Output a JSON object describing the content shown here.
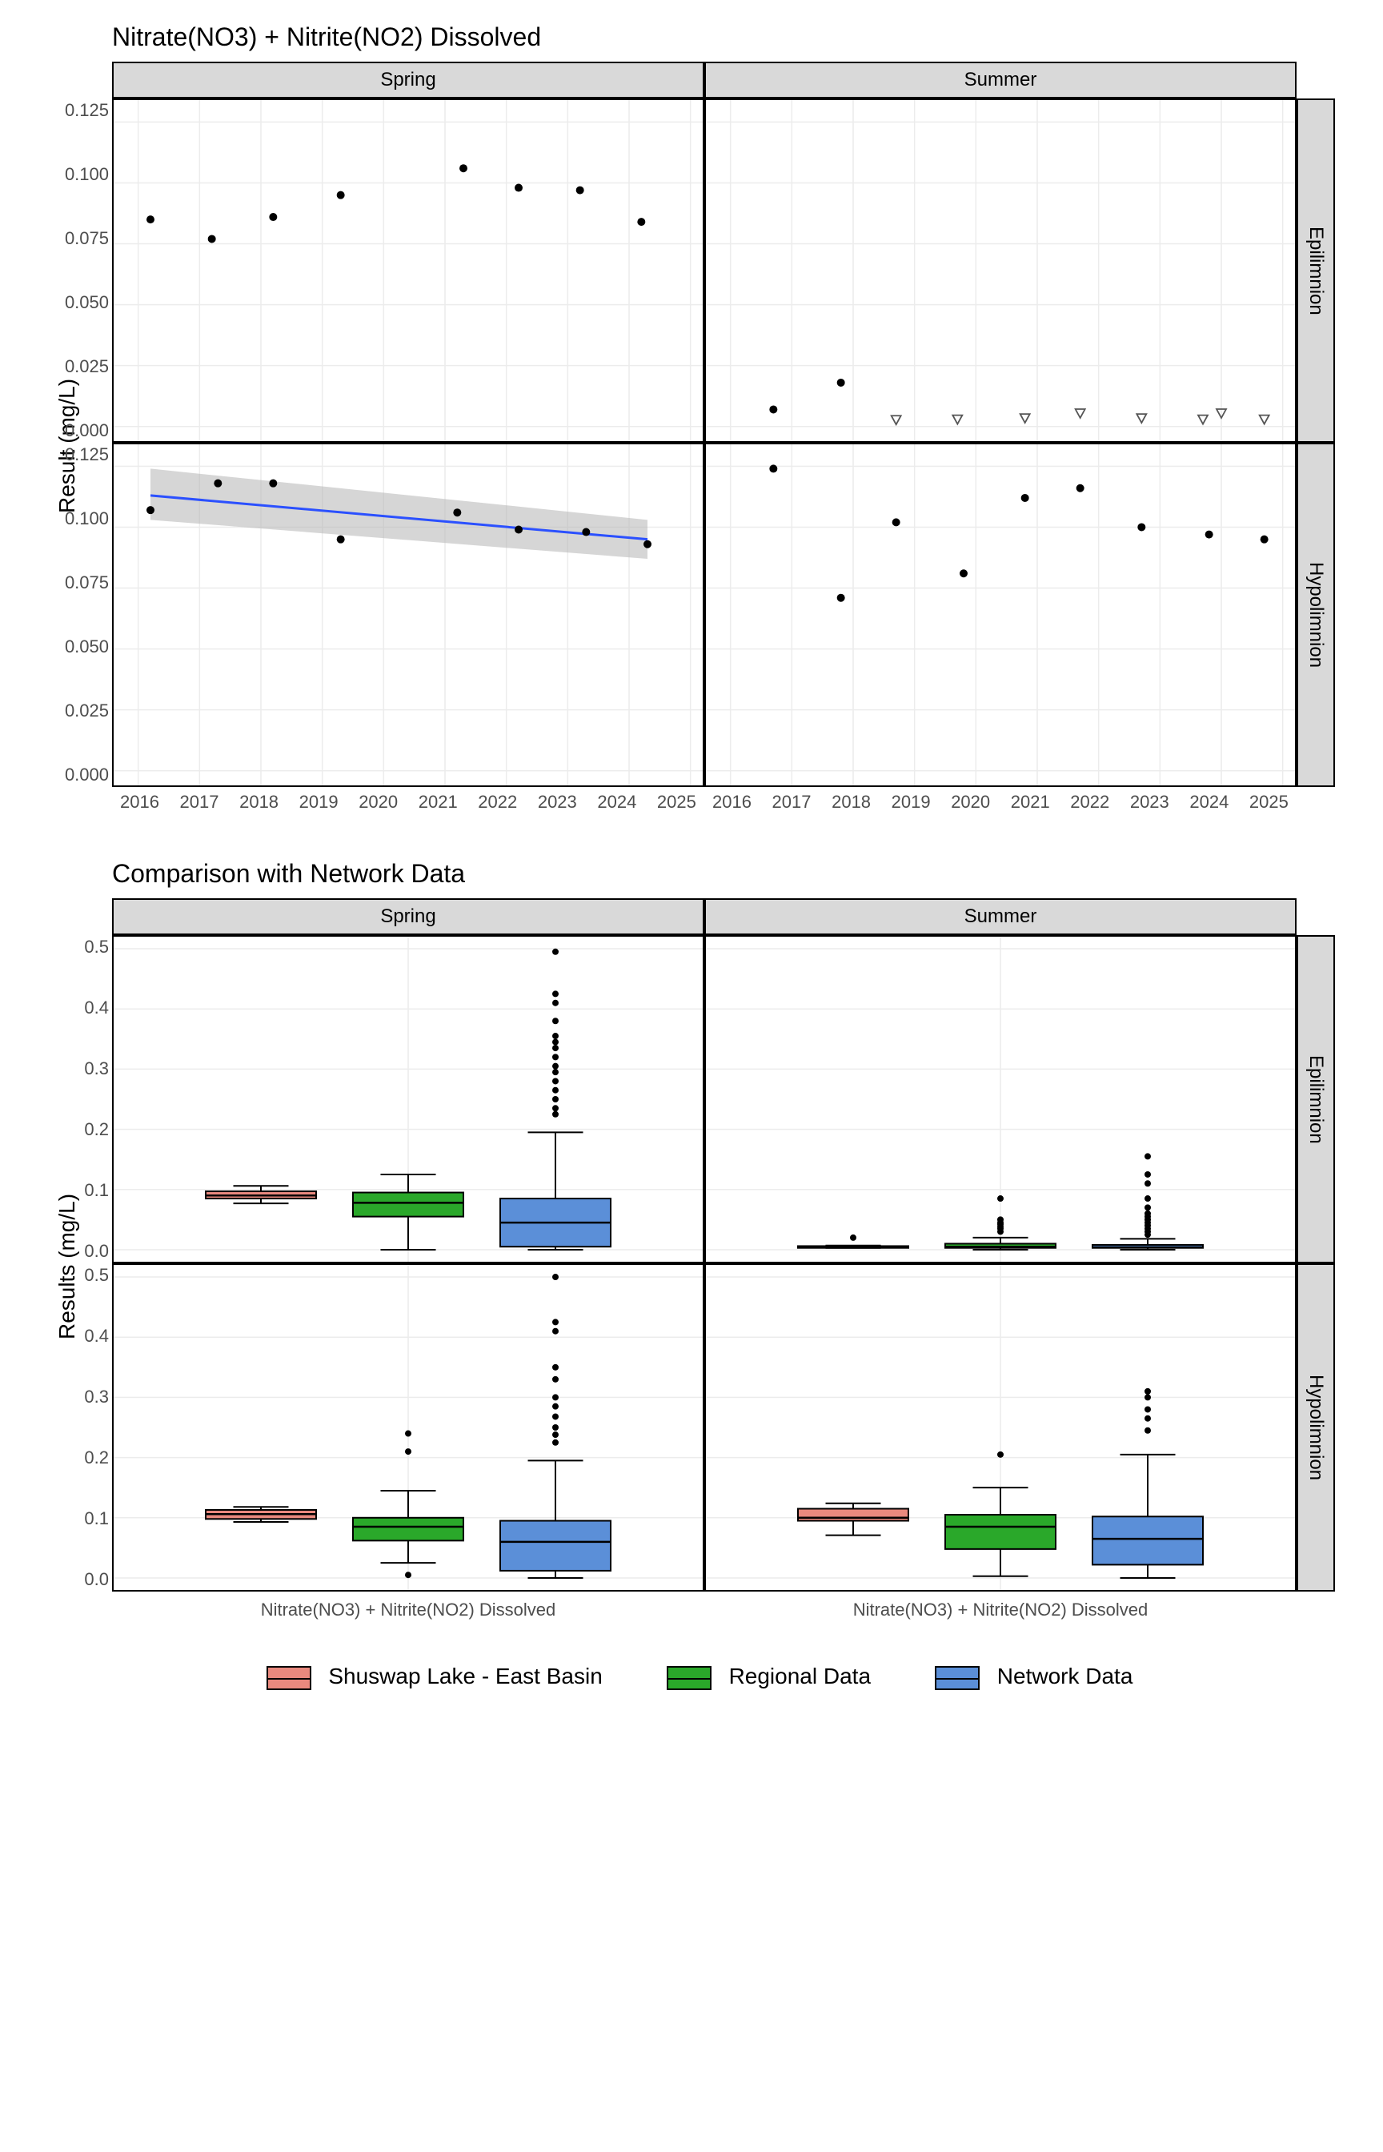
{
  "scatter": {
    "title": "Nitrate(NO3) + Nitrite(NO2) Dissolved",
    "ylabel": "Result (mg/L)",
    "cols": [
      "Spring",
      "Summer"
    ],
    "rows": [
      "Epilimnion",
      "Hypolimnion"
    ],
    "x_ticks": [
      "2016",
      "2017",
      "2018",
      "2019",
      "2020",
      "2021",
      "2022",
      "2023",
      "2024",
      "2025"
    ],
    "y_ticks": [
      "0.000",
      "0.025",
      "0.050",
      "0.075",
      "0.100",
      "0.125"
    ],
    "x_range": [
      2015.6,
      2025.2
    ],
    "y_range": [
      -0.006,
      0.134
    ]
  },
  "box": {
    "title": "Comparison with Network Data",
    "ylabel": "Results (mg/L)",
    "cols": [
      "Spring",
      "Summer"
    ],
    "rows": [
      "Epilimnion",
      "Hypolimnion"
    ],
    "y_ticks": [
      "0.0",
      "0.1",
      "0.2",
      "0.3",
      "0.4",
      "0.5"
    ],
    "y_range": [
      -0.02,
      0.52
    ],
    "category": "Nitrate(NO3) + Nitrite(NO2) Dissolved"
  },
  "legend": [
    {
      "label": "Shuswap Lake - East Basin",
      "color": "#e9897e"
    },
    {
      "label": "Regional Data",
      "color": "#2aa82a"
    },
    {
      "label": "Network Data",
      "color": "#5b8fd8"
    }
  ],
  "chart_data": {
    "scatter_panels": [
      {
        "col": "Spring",
        "row": "Epilimnion",
        "points": [
          {
            "x": 2016.2,
            "y": 0.085
          },
          {
            "x": 2017.2,
            "y": 0.077
          },
          {
            "x": 2018.2,
            "y": 0.086
          },
          {
            "x": 2019.3,
            "y": 0.095
          },
          {
            "x": 2021.3,
            "y": 0.106
          },
          {
            "x": 2022.2,
            "y": 0.098
          },
          {
            "x": 2023.2,
            "y": 0.097
          },
          {
            "x": 2024.2,
            "y": 0.084
          }
        ]
      },
      {
        "col": "Summer",
        "row": "Epilimnion",
        "points": [
          {
            "x": 2016.7,
            "y": 0.007
          },
          {
            "x": 2017.8,
            "y": 0.018
          }
        ],
        "open_points": [
          {
            "x": 2018.7,
            "y": 0.0028
          },
          {
            "x": 2019.7,
            "y": 0.003
          },
          {
            "x": 2020.8,
            "y": 0.0035
          },
          {
            "x": 2021.7,
            "y": 0.0055
          },
          {
            "x": 2022.7,
            "y": 0.0035
          },
          {
            "x": 2023.7,
            "y": 0.003
          },
          {
            "x": 2024.0,
            "y": 0.0055
          },
          {
            "x": 2024.7,
            "y": 0.003
          }
        ]
      },
      {
        "col": "Spring",
        "row": "Hypolimnion",
        "points": [
          {
            "x": 2016.2,
            "y": 0.107
          },
          {
            "x": 2017.3,
            "y": 0.118
          },
          {
            "x": 2018.2,
            "y": 0.118
          },
          {
            "x": 2019.3,
            "y": 0.095
          },
          {
            "x": 2021.2,
            "y": 0.106
          },
          {
            "x": 2022.2,
            "y": 0.099
          },
          {
            "x": 2023.3,
            "y": 0.098
          },
          {
            "x": 2024.3,
            "y": 0.093
          }
        ],
        "trend": {
          "x0": 2016.2,
          "y0": 0.113,
          "x1": 2024.3,
          "y1": 0.095,
          "band": [
            [
              2016.2,
              0.103,
              0.124
            ],
            [
              2024.3,
              0.087,
              0.103
            ]
          ]
        }
      },
      {
        "col": "Summer",
        "row": "Hypolimnion",
        "points": [
          {
            "x": 2016.7,
            "y": 0.124
          },
          {
            "x": 2017.8,
            "y": 0.071
          },
          {
            "x": 2018.7,
            "y": 0.102
          },
          {
            "x": 2019.8,
            "y": 0.081
          },
          {
            "x": 2020.8,
            "y": 0.112
          },
          {
            "x": 2021.7,
            "y": 0.116
          },
          {
            "x": 2022.7,
            "y": 0.1
          },
          {
            "x": 2023.8,
            "y": 0.097
          },
          {
            "x": 2024.7,
            "y": 0.095
          }
        ]
      }
    ],
    "box_panels": [
      {
        "col": "Spring",
        "row": "Epilimnion",
        "boxes": [
          {
            "series": "Shuswap Lake - East Basin",
            "min": 0.077,
            "q1": 0.085,
            "med": 0.09,
            "q3": 0.097,
            "max": 0.106,
            "outliers": []
          },
          {
            "series": "Regional Data",
            "min": 0.0,
            "q1": 0.055,
            "med": 0.078,
            "q3": 0.095,
            "max": 0.125,
            "outliers": []
          },
          {
            "series": "Network Data",
            "min": 0.0,
            "q1": 0.005,
            "med": 0.045,
            "q3": 0.085,
            "max": 0.195,
            "outliers": [
              0.225,
              0.235,
              0.25,
              0.265,
              0.28,
              0.295,
              0.305,
              0.32,
              0.335,
              0.345,
              0.355,
              0.38,
              0.41,
              0.425,
              0.495
            ]
          }
        ]
      },
      {
        "col": "Summer",
        "row": "Epilimnion",
        "boxes": [
          {
            "series": "Shuswap Lake - East Basin",
            "min": 0.003,
            "q1": 0.003,
            "med": 0.004,
            "q3": 0.006,
            "max": 0.007,
            "outliers": [
              0.02
            ]
          },
          {
            "series": "Regional Data",
            "min": 0.0,
            "q1": 0.003,
            "med": 0.005,
            "q3": 0.01,
            "max": 0.02,
            "outliers": [
              0.03,
              0.035,
              0.038,
              0.042,
              0.045,
              0.05,
              0.085
            ]
          },
          {
            "series": "Network Data",
            "min": 0.0,
            "q1": 0.003,
            "med": 0.004,
            "q3": 0.008,
            "max": 0.018,
            "outliers": [
              0.025,
              0.03,
              0.035,
              0.04,
              0.045,
              0.05,
              0.055,
              0.06,
              0.07,
              0.085,
              0.11,
              0.125,
              0.155
            ]
          }
        ]
      },
      {
        "col": "Spring",
        "row": "Hypolimnion",
        "boxes": [
          {
            "series": "Shuswap Lake - East Basin",
            "min": 0.093,
            "q1": 0.098,
            "med": 0.106,
            "q3": 0.113,
            "max": 0.118,
            "outliers": []
          },
          {
            "series": "Regional Data",
            "min": 0.025,
            "q1": 0.062,
            "med": 0.085,
            "q3": 0.1,
            "max": 0.145,
            "outliers": [
              0.005,
              0.21,
              0.24
            ]
          },
          {
            "series": "Network Data",
            "min": 0.0,
            "q1": 0.012,
            "med": 0.06,
            "q3": 0.095,
            "max": 0.195,
            "outliers": [
              0.225,
              0.238,
              0.25,
              0.268,
              0.285,
              0.3,
              0.33,
              0.35,
              0.41,
              0.425,
              0.5
            ]
          }
        ]
      },
      {
        "col": "Summer",
        "row": "Hypolimnion",
        "boxes": [
          {
            "series": "Shuswap Lake - East Basin",
            "min": 0.071,
            "q1": 0.095,
            "med": 0.1,
            "q3": 0.115,
            "max": 0.124,
            "outliers": []
          },
          {
            "series": "Regional Data",
            "min": 0.003,
            "q1": 0.048,
            "med": 0.085,
            "q3": 0.105,
            "max": 0.15,
            "outliers": [
              0.205
            ]
          },
          {
            "series": "Network Data",
            "min": 0.0,
            "q1": 0.022,
            "med": 0.065,
            "q3": 0.102,
            "max": 0.205,
            "outliers": [
              0.245,
              0.265,
              0.28,
              0.3,
              0.31
            ]
          }
        ]
      }
    ]
  }
}
